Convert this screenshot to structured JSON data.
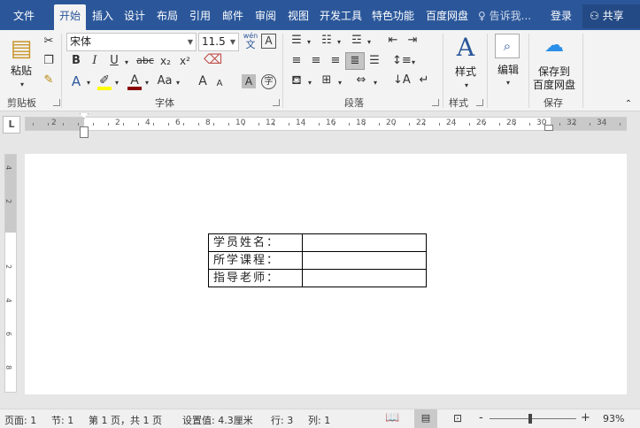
{
  "tabs": [
    "文件",
    "开始",
    "插入",
    "设计",
    "布局",
    "引用",
    "邮件",
    "审阅",
    "视图",
    "开发工具",
    "特色功能",
    "百度网盘"
  ],
  "active_tab": "开始",
  "tell_me": "告诉我...",
  "login": "登录",
  "share": "共享",
  "clipboard": {
    "paste": "粘贴",
    "label": "剪贴板"
  },
  "font": {
    "name": "宋体",
    "size": "11.5",
    "wen_label": "wén",
    "wen_char": "文",
    "label": "字体",
    "bold": "B",
    "italic": "I",
    "underline": "U",
    "strike": "abc",
    "subscript": "x₂",
    "superscript": "x²",
    "grow": "A",
    "shrink": "A",
    "case": "Aa",
    "char_shading": "A",
    "enclose": "字",
    "font_color": "A",
    "text_effect": "A"
  },
  "paragraph": {
    "label": "段落"
  },
  "styles": {
    "button": "样式",
    "label": "样式"
  },
  "editing": {
    "button": "编辑"
  },
  "save": {
    "line1": "保存到",
    "line2": "百度网盘",
    "label": "保存"
  },
  "ruler": {
    "corner": "L",
    "h_labels": [
      "2",
      "2",
      "4",
      "6",
      "8",
      "10",
      "12",
      "14",
      "16",
      "18",
      "20",
      "22",
      "24",
      "26",
      "28",
      "30",
      "32",
      "34"
    ],
    "v_labels": [
      "4",
      "2",
      "2",
      "4",
      "6",
      "8"
    ]
  },
  "document": {
    "rows": [
      {
        "label": "学员姓名：",
        "value": ""
      },
      {
        "label": "所学课程：",
        "value": ""
      },
      {
        "label": "指导老师：",
        "value": ""
      }
    ]
  },
  "status": {
    "page": "页面: 1",
    "section": "节: 1",
    "page_of": "第 1 页，共 1 页",
    "setting": "设置值: 4.3厘米",
    "line": "行: 3",
    "column": "列: 1",
    "zoom_minus": "-",
    "zoom_plus": "+",
    "zoom": "93%"
  },
  "colors": {
    "brand": "#2b579a",
    "highlight": "#ffff00",
    "font_color": "#c00000"
  }
}
